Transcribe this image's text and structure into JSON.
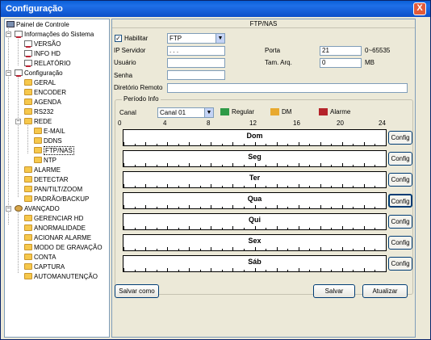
{
  "window": {
    "title": "Configuração",
    "close_label": "X"
  },
  "tree": {
    "root": "Painel de Controle",
    "items": [
      {
        "label": "Informações do Sistema"
      },
      {
        "label": "VERSÃO"
      },
      {
        "label": "INFO HD"
      },
      {
        "label": "RELATÓRIO"
      },
      {
        "label": "Configuração"
      },
      {
        "label": "GERAL"
      },
      {
        "label": "ENCODER"
      },
      {
        "label": "AGENDA"
      },
      {
        "label": "RS232"
      },
      {
        "label": "REDE"
      },
      {
        "label": "E-MAIL"
      },
      {
        "label": "DDNS"
      },
      {
        "label": "FTP/NAS"
      },
      {
        "label": "NTP"
      },
      {
        "label": "ALARME"
      },
      {
        "label": "DETECTAR"
      },
      {
        "label": "PAN/TILT/ZOOM"
      },
      {
        "label": "PADRÃO/BACKUP"
      },
      {
        "label": "AVANÇADO"
      },
      {
        "label": "GERENCIAR HD"
      },
      {
        "label": "ANORMALIDADE"
      },
      {
        "label": "ACIONAR ALARME"
      },
      {
        "label": "MODO DE GRAVAÇÃO"
      },
      {
        "label": "CONTA"
      },
      {
        "label": "CAPTURA"
      },
      {
        "label": "AUTOMANUTENÇÃO"
      }
    ]
  },
  "panel": {
    "title": "FTP/NAS",
    "enable_label": "Habilitar",
    "enable_checked": "✓",
    "protocol": "FTP",
    "ip_label": "IP Servidor",
    "ip_value": ".       .       .",
    "port_label": "Porta",
    "port_value": "21",
    "port_range": "0~65535",
    "user_label": "Usuário",
    "user_value": "",
    "size_label": "Tam. Arq.",
    "size_value": "0",
    "size_unit": "MB",
    "pass_label": "Senha",
    "pass_value": "",
    "dir_label": "Diretório Remoto",
    "dir_value": ""
  },
  "period": {
    "legend": "Período Info",
    "channel_label": "Canal",
    "channel_value": "Canal 01",
    "legend_items": [
      {
        "label": "Regular",
        "color": "#2f9a47"
      },
      {
        "label": "DM",
        "color": "#e8a92e"
      },
      {
        "label": "Alarme",
        "color": "#b5232a"
      }
    ],
    "hours": [
      "0",
      "4",
      "8",
      "12",
      "16",
      "20",
      "24"
    ],
    "days": [
      "Dom",
      "Seg",
      "Ter",
      "Qua",
      "Qui",
      "Sex",
      "Sáb"
    ],
    "config_label": "Config"
  },
  "buttons": {
    "save_as": "Salvar como",
    "save": "Salvar",
    "refresh": "Atualizar"
  }
}
